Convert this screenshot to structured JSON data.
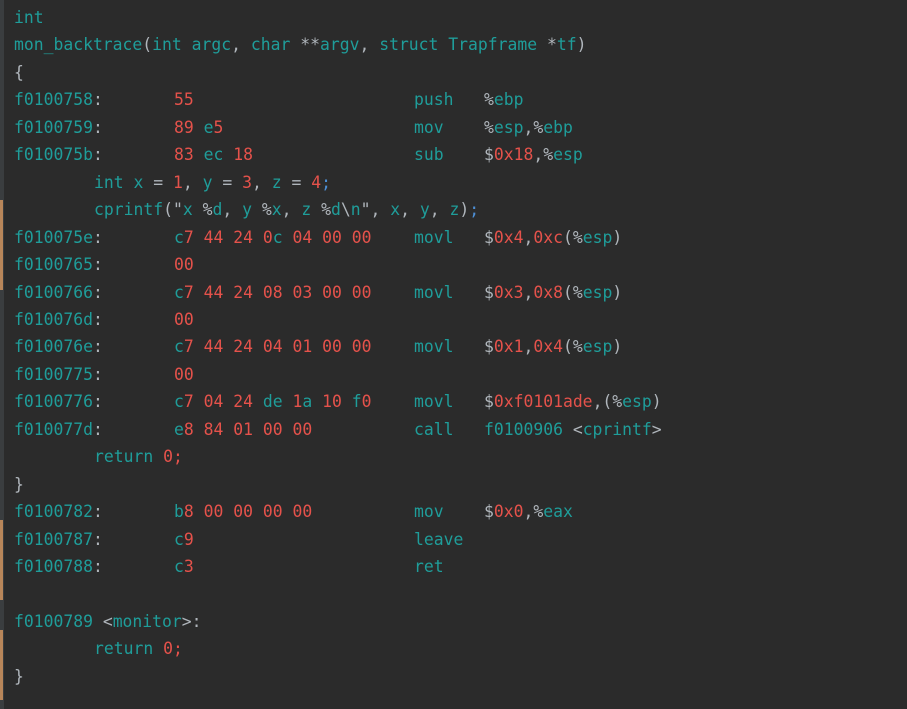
{
  "colors": {
    "background": "#2b2b2b",
    "teal": "#1f9d9a",
    "red": "#e5524b",
    "gray": "#b0b6bc",
    "blue": "#4d8fd6"
  },
  "lines": [
    {
      "kind": "src",
      "indent": false,
      "tokens": [
        [
          "int",
          "t"
        ]
      ]
    },
    {
      "kind": "src",
      "indent": false,
      "tokens": [
        [
          "mon_backtrace",
          "t"
        ],
        [
          "(",
          "g"
        ],
        [
          "int argc",
          "t"
        ],
        [
          ", ",
          "g"
        ],
        [
          "char ",
          "t"
        ],
        [
          "**",
          "g"
        ],
        [
          "argv",
          "t"
        ],
        [
          ", ",
          "g"
        ],
        [
          "struct Trapframe ",
          "t"
        ],
        [
          "*",
          "g"
        ],
        [
          "tf",
          "t"
        ],
        [
          ")",
          "g"
        ]
      ]
    },
    {
      "kind": "src",
      "indent": false,
      "tokens": [
        [
          "{",
          "g"
        ]
      ]
    },
    {
      "kind": "asm",
      "addr": "f0100758",
      "bytes": "55",
      "mnemonic": "push",
      "operands": [
        [
          "%",
          "g"
        ],
        [
          "ebp",
          "t"
        ]
      ]
    },
    {
      "kind": "asm",
      "addr": "f0100759",
      "bytes": "89 e5",
      "mnemonic": "mov",
      "operands": [
        [
          "%",
          "g"
        ],
        [
          "esp",
          "t"
        ],
        [
          ",%",
          "g"
        ],
        [
          "ebp",
          "t"
        ]
      ]
    },
    {
      "kind": "asm",
      "addr": "f010075b",
      "bytes": "83 ec 18",
      "mnemonic": "sub",
      "operands": [
        [
          "$",
          "g"
        ],
        [
          "0x18",
          "r"
        ],
        [
          ",%",
          "g"
        ],
        [
          "esp",
          "t"
        ]
      ]
    },
    {
      "kind": "src",
      "indent": true,
      "tokens": [
        [
          "int x ",
          "t"
        ],
        [
          "= ",
          "g"
        ],
        [
          "1",
          "r"
        ],
        [
          ", ",
          "g"
        ],
        [
          "y ",
          "t"
        ],
        [
          "= ",
          "g"
        ],
        [
          "3",
          "r"
        ],
        [
          ", ",
          "g"
        ],
        [
          "z ",
          "t"
        ],
        [
          "= ",
          "g"
        ],
        [
          "4",
          "r"
        ],
        [
          ";",
          "b"
        ]
      ]
    },
    {
      "kind": "src",
      "indent": true,
      "tokens": [
        [
          "cprintf",
          "t"
        ],
        [
          "(\"",
          "g"
        ],
        [
          "x ",
          "t"
        ],
        [
          "%",
          "g"
        ],
        [
          "d",
          "t"
        ],
        [
          ", ",
          "g"
        ],
        [
          "y ",
          "t"
        ],
        [
          "%",
          "g"
        ],
        [
          "x",
          "t"
        ],
        [
          ", ",
          "g"
        ],
        [
          "z ",
          "t"
        ],
        [
          "%",
          "g"
        ],
        [
          "d",
          "t"
        ],
        [
          "\\",
          "g"
        ],
        [
          "n",
          "t"
        ],
        [
          "\", ",
          "g"
        ],
        [
          "x",
          "t"
        ],
        [
          ", ",
          "g"
        ],
        [
          "y",
          "t"
        ],
        [
          ", ",
          "g"
        ],
        [
          "z",
          "t"
        ],
        [
          ")",
          "g"
        ],
        [
          ";",
          "b"
        ]
      ]
    },
    {
      "kind": "asm",
      "addr": "f010075e",
      "bytes": "c7 44 24 0c 04 00 00",
      "mnemonic": "movl",
      "operands": [
        [
          "$",
          "g"
        ],
        [
          "0x4",
          "r"
        ],
        [
          ",",
          "g"
        ],
        [
          "0xc",
          "r"
        ],
        [
          "(%",
          "g"
        ],
        [
          "esp",
          "t"
        ],
        [
          ")",
          "g"
        ]
      ]
    },
    {
      "kind": "asm",
      "addr": "f0100765",
      "bytes": "00",
      "mnemonic": "",
      "operands": []
    },
    {
      "kind": "asm",
      "addr": "f0100766",
      "bytes": "c7 44 24 08 03 00 00",
      "mnemonic": "movl",
      "operands": [
        [
          "$",
          "g"
        ],
        [
          "0x3",
          "r"
        ],
        [
          ",",
          "g"
        ],
        [
          "0x8",
          "r"
        ],
        [
          "(%",
          "g"
        ],
        [
          "esp",
          "t"
        ],
        [
          ")",
          "g"
        ]
      ]
    },
    {
      "kind": "asm",
      "addr": "f010076d",
      "bytes": "00",
      "mnemonic": "",
      "operands": []
    },
    {
      "kind": "asm",
      "addr": "f010076e",
      "bytes": "c7 44 24 04 01 00 00",
      "mnemonic": "movl",
      "operands": [
        [
          "$",
          "g"
        ],
        [
          "0x1",
          "r"
        ],
        [
          ",",
          "g"
        ],
        [
          "0x4",
          "r"
        ],
        [
          "(%",
          "g"
        ],
        [
          "esp",
          "t"
        ],
        [
          ")",
          "g"
        ]
      ]
    },
    {
      "kind": "asm",
      "addr": "f0100775",
      "bytes": "00",
      "mnemonic": "",
      "operands": []
    },
    {
      "kind": "asm",
      "addr": "f0100776",
      "bytes": "c7 04 24 de 1a 10 f0",
      "mnemonic": "movl",
      "operands": [
        [
          "$",
          "g"
        ],
        [
          "0xf0101ade",
          "r"
        ],
        [
          ",(%",
          "g"
        ],
        [
          "esp",
          "t"
        ],
        [
          ")",
          "g"
        ]
      ]
    },
    {
      "kind": "asm",
      "addr": "f010077d",
      "bytes": "e8 84 01 00 00",
      "mnemonic": "call",
      "operands": [
        [
          "f0100906 ",
          "t"
        ],
        [
          "<",
          "g"
        ],
        [
          "cprintf",
          "t"
        ],
        [
          ">",
          "g"
        ]
      ]
    },
    {
      "kind": "src",
      "indent": true,
      "tokens": [
        [
          "return ",
          "t"
        ],
        [
          "0",
          "r"
        ],
        [
          ";",
          "r"
        ]
      ]
    },
    {
      "kind": "src",
      "indent": false,
      "tokens": [
        [
          "}",
          "g"
        ]
      ]
    },
    {
      "kind": "asm",
      "addr": "f0100782",
      "bytes": "b8 00 00 00 00",
      "mnemonic": "mov",
      "operands": [
        [
          "$",
          "g"
        ],
        [
          "0x0",
          "r"
        ],
        [
          ",%",
          "g"
        ],
        [
          "eax",
          "t"
        ]
      ]
    },
    {
      "kind": "asm",
      "addr": "f0100787",
      "bytes": "c9",
      "mnemonic": "leave",
      "operands": []
    },
    {
      "kind": "asm",
      "addr": "f0100788",
      "bytes": "c3",
      "mnemonic": "ret",
      "operands": []
    },
    {
      "kind": "src",
      "indent": false,
      "tokens": []
    },
    {
      "kind": "src",
      "indent": false,
      "tokens": [
        [
          "f0100789 ",
          "t"
        ],
        [
          "<",
          "g"
        ],
        [
          "monitor",
          "t"
        ],
        [
          ">:",
          "g"
        ]
      ]
    },
    {
      "kind": "src",
      "indent": true,
      "tokens": [
        [
          "return ",
          "t"
        ],
        [
          "0",
          "r"
        ],
        [
          ";",
          "r"
        ]
      ]
    },
    {
      "kind": "src",
      "indent": false,
      "tokens": [
        [
          "}",
          "g"
        ]
      ]
    }
  ]
}
